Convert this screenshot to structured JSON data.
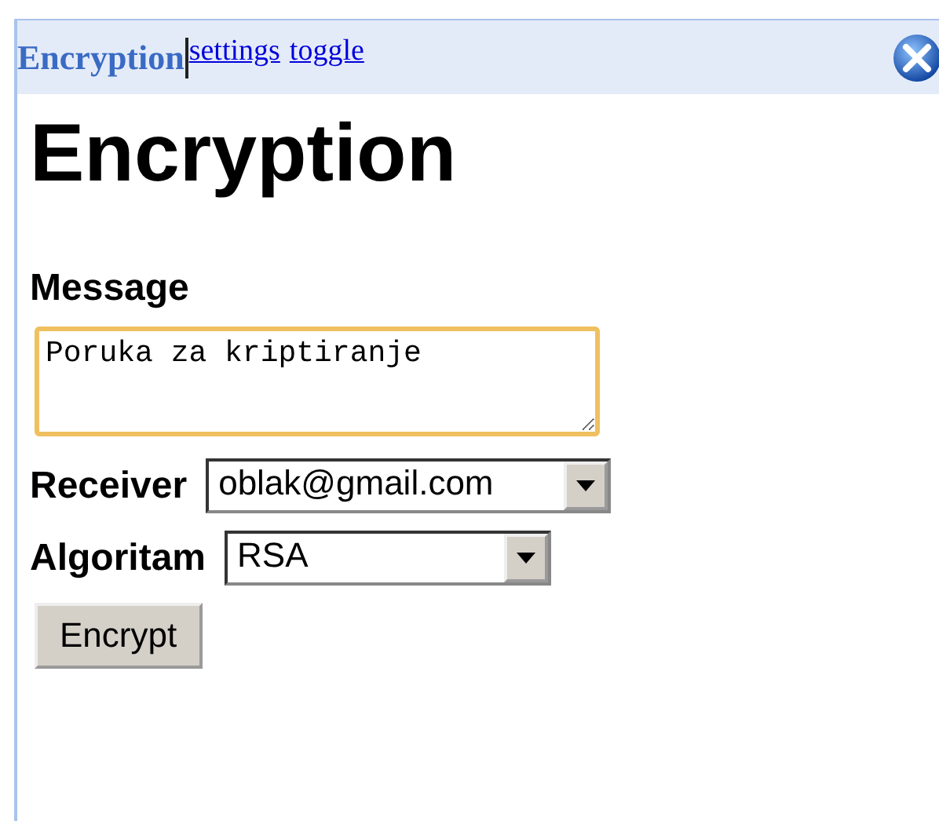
{
  "gadget_header": {
    "title": "Encryption",
    "links": [
      "settings",
      "toggle"
    ]
  },
  "heading": "Encryption",
  "message": {
    "label": "Message",
    "value": "Poruka za kriptiranje",
    "focused": true
  },
  "fields": [
    {
      "label": "Receiver",
      "value": "oblak@gmail.com"
    },
    {
      "label": "Algoritam",
      "value": "RSA"
    }
  ],
  "buttons": [
    "Encrypt"
  ]
}
